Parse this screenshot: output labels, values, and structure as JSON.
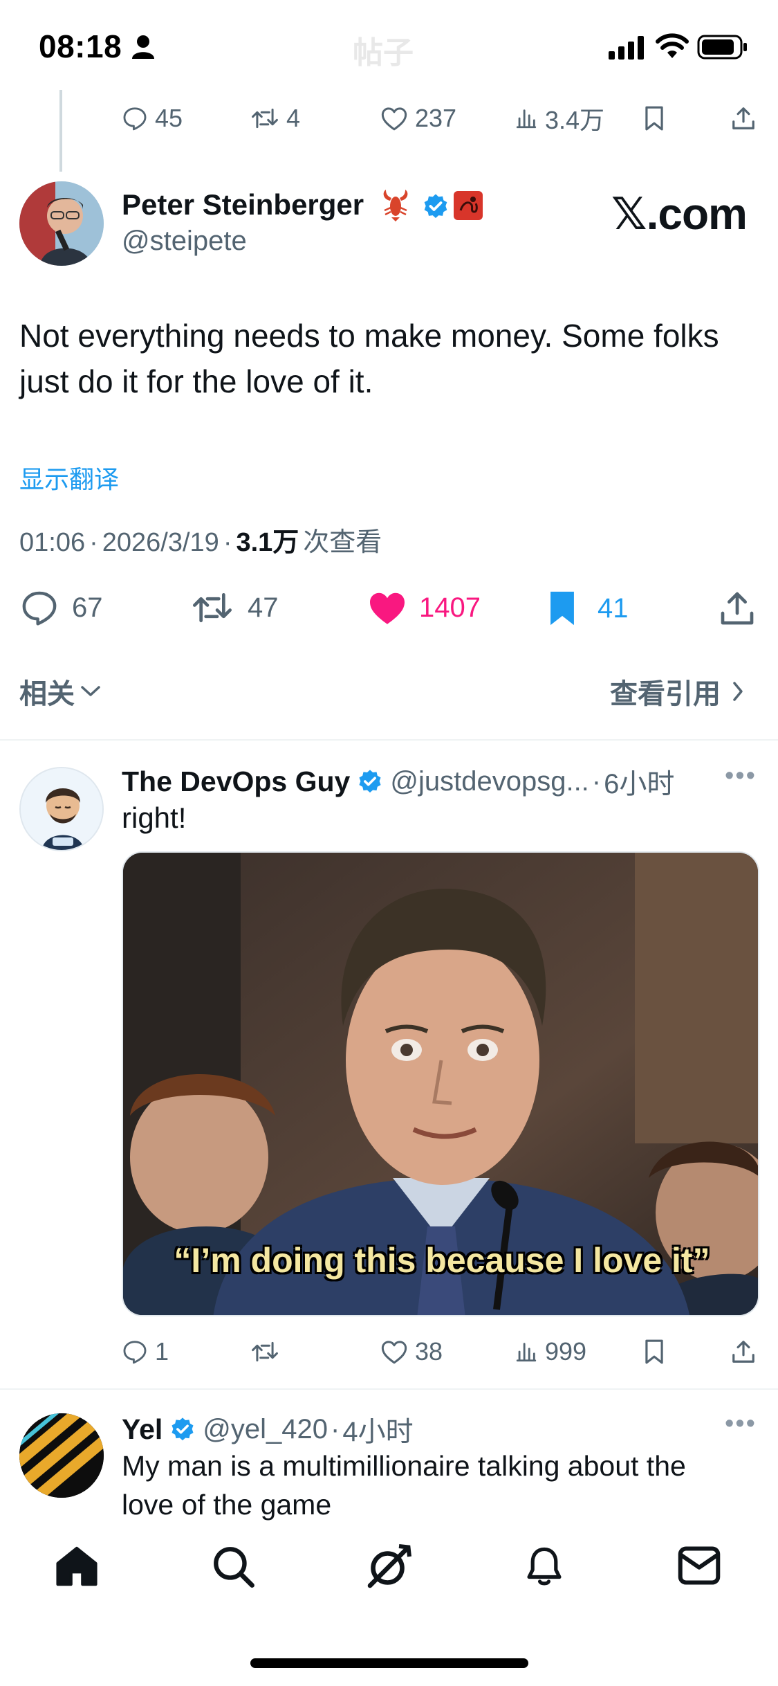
{
  "status_bar": {
    "time": "08:18",
    "title": "帖子"
  },
  "prev_post_actions": {
    "replies": "45",
    "reposts": "4",
    "likes": "237",
    "views": "3.4万"
  },
  "main_post": {
    "author_name": "Peter Steinberger",
    "author_handle": "@steipete",
    "watermark": "𝕏.com",
    "text": "Not everything needs to make money. Some folks just do it for the love of it.",
    "translate_label": "显示翻译",
    "time": "01:06",
    "date": "2026/3/19",
    "views_count": "3.1万",
    "views_label": "次查看",
    "stats": {
      "replies": "67",
      "reposts": "47",
      "likes": "1407",
      "bookmarks": "41"
    },
    "related_label": "相关",
    "quotes_label": "查看引用"
  },
  "reply1": {
    "author_name": "The DevOps Guy",
    "author_handle": "@justdevopsg...",
    "time_ago": "6小时",
    "text": "right!",
    "image_caption": "“I’m doing this because I love it”",
    "stats": {
      "replies": "1",
      "likes": "38",
      "views": "999"
    }
  },
  "reply2": {
    "author_name": "Yel",
    "author_handle": "@yel_420",
    "time_ago": "4小时",
    "text": "My man is a multimillionaire talking about the love of the game"
  },
  "colors": {
    "accent": "#1d9bf0",
    "like": "#f91880",
    "text": "#0f1419",
    "muted": "#536471"
  },
  "tab_bar": {
    "items": [
      "home-icon",
      "search-icon",
      "grok-icon",
      "bell-icon",
      "mail-icon"
    ]
  }
}
